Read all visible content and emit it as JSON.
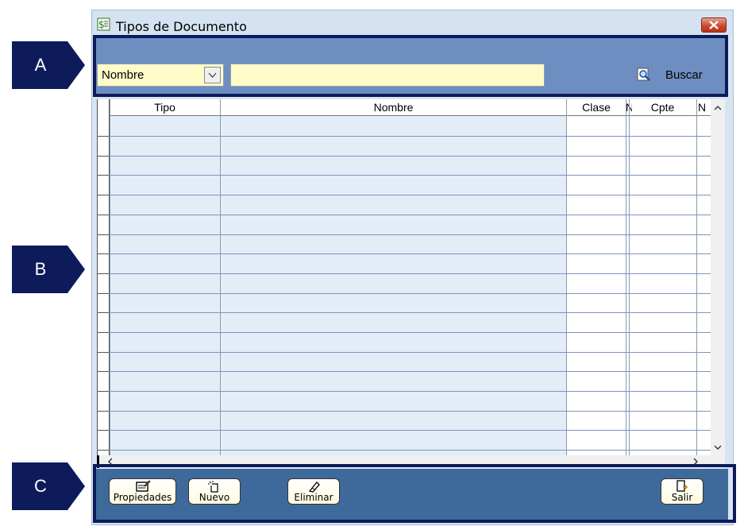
{
  "window": {
    "title": "Tipos de Documento"
  },
  "search": {
    "field": "Nombre",
    "value": "",
    "button_label": "Buscar"
  },
  "grid": {
    "columns": [
      "Tipo",
      "Nombre",
      "Clase",
      "N",
      "Cpte",
      "N"
    ],
    "rows": []
  },
  "toolbar": {
    "properties_label": "Propiedades",
    "new_label": "Nuevo",
    "delete_label": "Eliminar",
    "exit_label": "Salir"
  },
  "annotations": {
    "a": "A",
    "b": "B",
    "c": "C"
  },
  "colors": {
    "panel": "#6e8ec1",
    "footer": "#3e6a9b",
    "callout": "#0d1b5a",
    "input_bg": "#fffbc8"
  }
}
